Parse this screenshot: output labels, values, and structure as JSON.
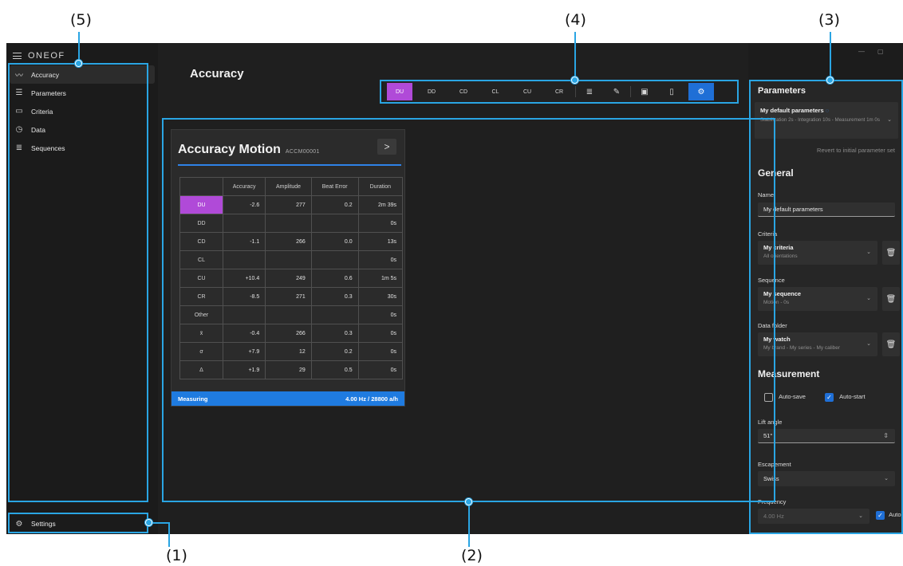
{
  "callouts": {
    "c1": "(1)",
    "c2": "(2)",
    "c3": "(3)",
    "c4": "(4)",
    "c5": "(5)"
  },
  "app": {
    "brand": "ONEOF"
  },
  "sidebar": {
    "items": [
      {
        "label": "Accuracy",
        "icon": "wave-icon",
        "glyph": "〰"
      },
      {
        "label": "Parameters",
        "icon": "sliders-icon",
        "glyph": "☰"
      },
      {
        "label": "Criteria",
        "icon": "monitor-icon",
        "glyph": "▭"
      },
      {
        "label": "Data",
        "icon": "timer-icon",
        "glyph": "◷"
      },
      {
        "label": "Sequences",
        "icon": "list-icon",
        "glyph": "≣"
      }
    ],
    "settings": "Settings"
  },
  "main": {
    "title": "Accuracy",
    "toolbar": {
      "positions": [
        "DU",
        "DD",
        "CD",
        "CL",
        "CU",
        "CR"
      ],
      "selected": "DU"
    }
  },
  "card": {
    "title": "Accuracy Motion",
    "subtitle": "ACCM00001",
    "columns": [
      "Accuracy",
      "Amplitude",
      "Beat Error",
      "Duration"
    ],
    "rows": [
      {
        "h": "DU",
        "v": [
          "-2.6",
          "277",
          "0.2",
          "2m 39s"
        ]
      },
      {
        "h": "DD",
        "v": [
          "",
          "",
          "",
          "0s"
        ]
      },
      {
        "h": "CD",
        "v": [
          "-1.1",
          "266",
          "0.0",
          "13s"
        ]
      },
      {
        "h": "CL",
        "v": [
          "",
          "",
          "",
          "0s"
        ]
      },
      {
        "h": "CU",
        "v": [
          "+10.4",
          "249",
          "0.6",
          "1m 5s"
        ]
      },
      {
        "h": "CR",
        "v": [
          "-8.5",
          "271",
          "0.3",
          "30s"
        ]
      },
      {
        "h": "Other",
        "v": [
          "",
          "",
          "",
          "0s"
        ]
      },
      {
        "h": "x̄",
        "v": [
          "-0.4",
          "266",
          "0.3",
          "0s"
        ]
      },
      {
        "h": "σ",
        "v": [
          "+7.9",
          "12",
          "0.2",
          "0s"
        ]
      },
      {
        "h": "Δ",
        "v": [
          "+1.9",
          "29",
          "0.5",
          "0s"
        ]
      }
    ],
    "status": "Measuring",
    "frequency": "4.00 Hz / 28800 a/h"
  },
  "panel": {
    "title": "Parameters",
    "preset": {
      "name": "My default parameters",
      "detail": "Stabilization 2s - Integration 10s - Measurement 1m 0s"
    },
    "revert": "Revert to initial parameter set",
    "general": "General",
    "name_label": "Name",
    "name_value": "My default parameters",
    "criteria_label": "Criteria",
    "criteria": {
      "title": "My criteria",
      "sub": "All orientations"
    },
    "sequence_label": "Sequence",
    "sequence": {
      "title": "My sequence",
      "sub": "Motion - 0s"
    },
    "folder_label": "Data folder",
    "folder": {
      "title": "My watch",
      "sub": "My brand - My series - My caliber"
    },
    "measurement": "Measurement",
    "autosave": "Auto-save",
    "autostart": "Auto-start",
    "lift_label": "Lift angle",
    "lift_value": "51°",
    "escapement_label": "Escapement",
    "escapement_value": "Swiss",
    "frequency_label": "Frequency",
    "frequency_value": "4.00 Hz",
    "auto": "Auto"
  },
  "colors": {
    "accent": "#2aa5e3",
    "selected": "#b04ad8",
    "primary": "#1f7be0"
  }
}
